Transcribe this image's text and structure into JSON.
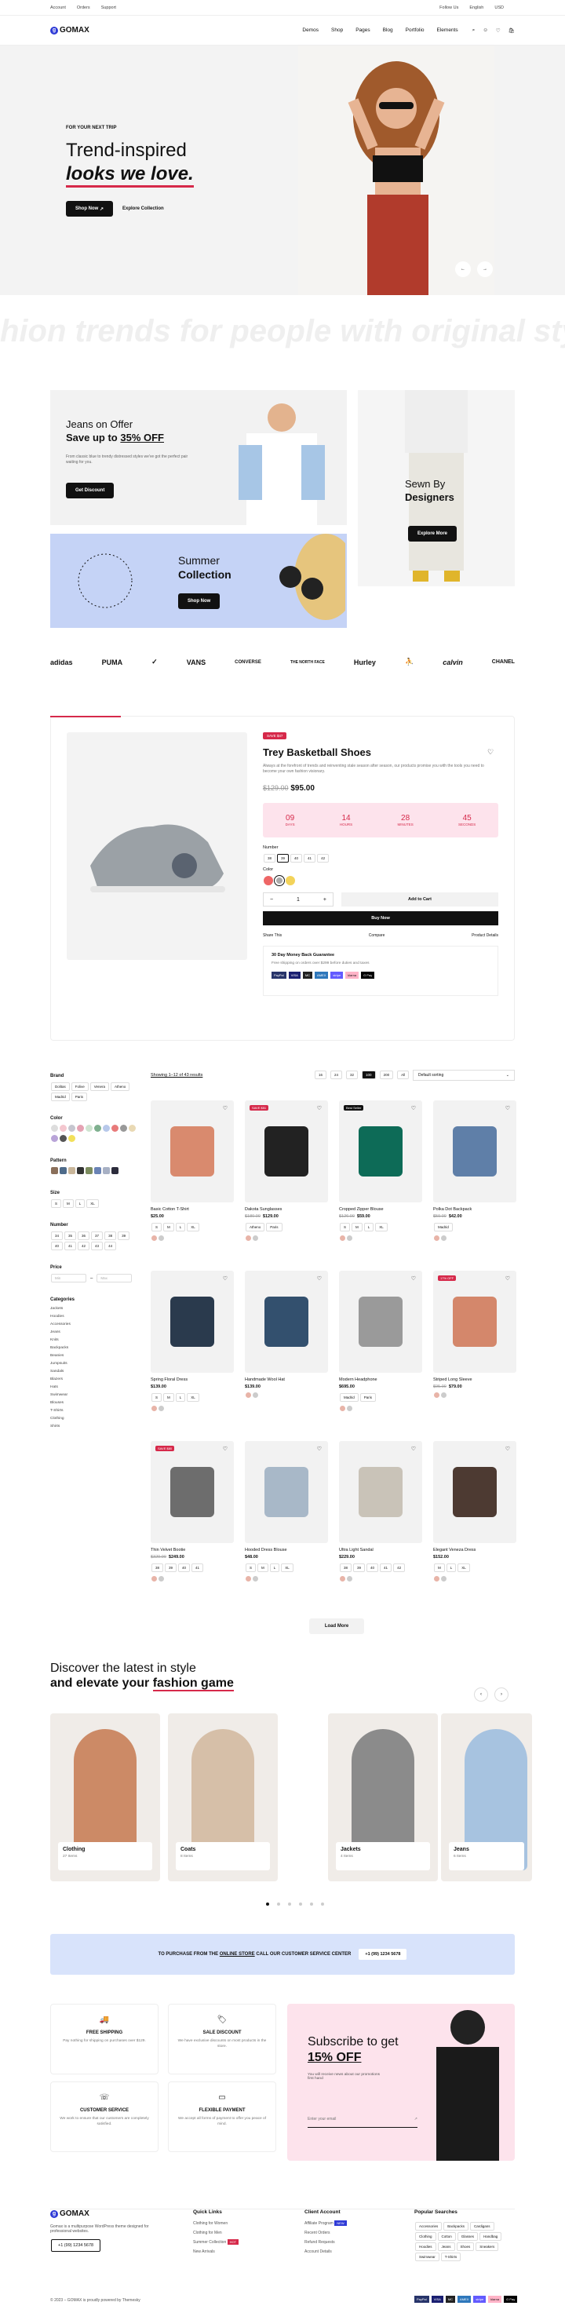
{
  "topbar": {
    "account": "Account",
    "orders": "Orders",
    "support": "Support",
    "follow": "Follow Us",
    "language": "English",
    "currency": "USD"
  },
  "nav": {
    "logo": "GOMAX",
    "items": [
      "Demos",
      "Shop",
      "Pages",
      "Blog",
      "Portfolio",
      "Elements"
    ]
  },
  "hero": {
    "eyebrow": "FOR YOUR NEXT TRIP",
    "title1": "Trend-inspired",
    "title2": "looks we love.",
    "shop": "Shop Now",
    "explore": "Explore Collection"
  },
  "marquee": "hion trends for people with original style.",
  "promo": {
    "jeans_label": "Jeans on Offer",
    "jeans_title": "Save up to",
    "jeans_pct": "35% OFF",
    "jeans_desc": "From classic blue to trendy distressed styles we've got the perfect pair waiting for you.",
    "jeans_btn": "Get Discount",
    "sewn1": "Sewn By",
    "sewn2": "Designers",
    "sewn_btn": "Explore More",
    "summer1": "Summer",
    "summer2": "Collection",
    "summer_btn": "Shop Now"
  },
  "brands": [
    "adidas",
    "PUMA",
    "✓",
    "VANS",
    "CONVERSE",
    "THE NORTH FACE",
    "Hurley",
    "⛹",
    "calvin",
    "CHANEL"
  ],
  "featured": {
    "badge": "SAVE $47",
    "title": "Trey Basketball Shoes",
    "desc": "Always at the forefront of trends and reinventing stale season after season, our products promise you with the tools you need to become your own fashion visionary.",
    "old": "$129.00",
    "price": "$95.00",
    "countdown": [
      {
        "v": "09",
        "l": "DAYS"
      },
      {
        "v": "14",
        "l": "HOURS"
      },
      {
        "v": "28",
        "l": "MINUTES"
      },
      {
        "v": "45",
        "l": "SECONDS"
      }
    ],
    "number_label": "Number",
    "numbers": [
      "38",
      "39",
      "40",
      "41",
      "42"
    ],
    "color_label": "Color",
    "qty": "1",
    "add": "Add to Cart",
    "buy": "Buy Now",
    "share": "Share This",
    "compare": "Compare",
    "details": "Product Details",
    "guarantee": "30 Day Money Back Guarantee",
    "shipping": "Free shipping on orders over $299 before duties and taxes",
    "payments": [
      "PayPal",
      "VISA",
      "MC",
      "AMEX",
      "stripe",
      "klarna",
      "G Pay"
    ]
  },
  "filters": {
    "brand": "Brand",
    "brands": [
      "Dolitas",
      "Folive",
      "Venera",
      "Atheno",
      "Madrid",
      "Paris"
    ],
    "color": "Color",
    "pattern": "Pattern",
    "size": "Size",
    "sizes": [
      "S",
      "M",
      "L",
      "XL"
    ],
    "number": "Number",
    "numbers": [
      "34",
      "35",
      "36",
      "37",
      "38",
      "39",
      "40",
      "41",
      "42",
      "43",
      "44"
    ],
    "price": "Price",
    "min": "Min",
    "max": "Max",
    "categories": "Categories",
    "cats": [
      "Jackets",
      "Hoodies",
      "Accessories",
      "Jeans",
      "Knits",
      "Backpacks",
      "Beanies",
      "Jumpsuits",
      "Sandals",
      "Blazers",
      "Hats",
      "Swimwear",
      "Blouses",
      "T-Shirts",
      "Clothing",
      "Shirts"
    ]
  },
  "shop": {
    "showing": "Showing 1–12 of 43 results",
    "sort": "Default sorting",
    "pages": [
      "16",
      "24",
      "32",
      "100",
      "200",
      "All"
    ],
    "load": "Load More"
  },
  "products": [
    {
      "name": "Basic Cotton T-Shirt",
      "old": "",
      "price": "$25.00",
      "tag": "",
      "opts": [
        "S",
        "M",
        "L",
        "XL"
      ]
    },
    {
      "name": "Dakota Sunglasses",
      "old": "$180.00",
      "price": "$129.00",
      "tag": "SAVE $51",
      "opts": [
        "Atheno",
        "Paris"
      ]
    },
    {
      "name": "Cropped Zipper Blouse",
      "old": "$126.00",
      "price": "$59.00",
      "tag": "Best Seller",
      "opts": [
        "S",
        "M",
        "L",
        "XL"
      ]
    },
    {
      "name": "Polka Dot Backpack",
      "old": "$59.00",
      "price": "$42.00",
      "tag": "",
      "opts": [
        "Madrid"
      ]
    },
    {
      "name": "Spring Floral Dress",
      "old": "",
      "price": "$139.00",
      "tag": "",
      "opts": [
        "S",
        "M",
        "L",
        "XL"
      ]
    },
    {
      "name": "Handmade Wool Hat",
      "old": "",
      "price": "$139.00",
      "tag": "",
      "opts": []
    },
    {
      "name": "Modern Headphone",
      "old": "",
      "price": "$695.00",
      "tag": "",
      "opts": [
        "Madrid",
        "Paris"
      ]
    },
    {
      "name": "Striped Long Sleeve",
      "old": "$95.00",
      "price": "$79.00",
      "tag": "17% OFF",
      "opts": []
    },
    {
      "name": "Thin Velvet Bootie",
      "old": "$329.00",
      "price": "$249.00",
      "tag": "SAVE $80",
      "opts": [
        "38",
        "39",
        "40",
        "41"
      ]
    },
    {
      "name": "Hooded Dress Blouse",
      "old": "",
      "price": "$48.00",
      "tag": "",
      "opts": [
        "S",
        "M",
        "L",
        "XL"
      ]
    },
    {
      "name": "Ultra Light Sandal",
      "old": "",
      "price": "$229.00",
      "tag": "",
      "opts": [
        "38",
        "39",
        "40",
        "41",
        "42"
      ]
    },
    {
      "name": "Elegant Veneza Dress",
      "old": "",
      "price": "$152.00",
      "tag": "",
      "opts": [
        "M",
        "L",
        "XL"
      ]
    }
  ],
  "discover": {
    "line1": "Discover the latest in style",
    "line2a": "and elevate your ",
    "line2b": "fashion game",
    "cats": [
      {
        "n": "Clothing",
        "c": "27 Items"
      },
      {
        "n": "Coats",
        "c": "8 Items"
      },
      {
        "n": "Jackets",
        "c": "4 Items"
      },
      {
        "n": "Jeans",
        "c": "6 Items"
      }
    ]
  },
  "banner": {
    "text1": "TO PURCHASE FROM THE ",
    "link": "ONLINE STORE",
    "text2": " CALL OUR CUSTOMER SERVICE CENTER",
    "phone": "+1 (99) 1234 5678"
  },
  "features": [
    {
      "t": "FREE SHIPPING",
      "d": "Pay nothing for shipping on purchases over $129."
    },
    {
      "t": "SALE DISCOUNT",
      "d": "We have exclusive discounts on most products in the store."
    },
    {
      "t": "CUSTOMER SERVICE",
      "d": "We work to ensure that our customers are completely satisfied."
    },
    {
      "t": "FLEXIBLE PAYMENT",
      "d": "We accept all forms of payment to offer you peace of mind."
    }
  ],
  "subscribe": {
    "title1": "Subscribe to get",
    "title2": "15% OFF",
    "desc": "You will receive news about our promotions first hand",
    "placeholder": "Enter your email"
  },
  "footer": {
    "about": "Gomax is a multipurpose WordPress theme designed for professional websites.",
    "phone": "+1 (99) 1234 5678",
    "quick": "Quick Links",
    "quick_items": [
      "Clothing for Women",
      "Clothing for Men",
      "Summer Collection",
      "New Arrivals"
    ],
    "hot": "HOT",
    "client": "Client Account",
    "client_items": [
      "Affiliate Program",
      "Recent Orders",
      "Refund Requests",
      "Account Details"
    ],
    "new": "NEW",
    "popular": "Popular Searches",
    "tags": [
      "Accessories",
      "Backpacks",
      "Cardigans",
      "Clothing",
      "Cotton",
      "Glasses",
      "Handbag",
      "Hoodies",
      "Jeans",
      "Shoes",
      "Sneakers",
      "Swimwear",
      "T-Shirts"
    ],
    "copyright": "© 2023 – GOMAX is proudly powered by Themesky"
  },
  "colors": {
    "accent": "#d6294a",
    "brand": "#2e3ad6",
    "pink": "#fde3ec",
    "blue": "#c5d3f6",
    "banner": "#d8e3fb"
  }
}
